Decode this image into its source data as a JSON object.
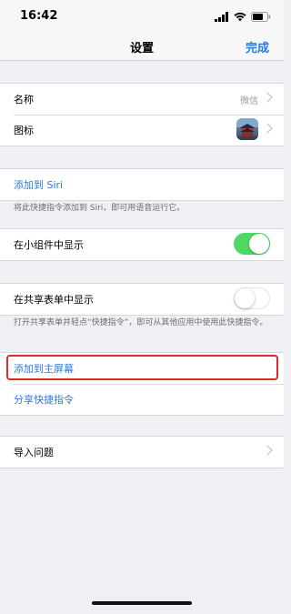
{
  "status_bar": {
    "time": "16:42"
  },
  "nav": {
    "title": "设置",
    "done_label": "完成"
  },
  "name_section": {
    "name_label": "名称",
    "name_value": "微信",
    "icon_label": "图标"
  },
  "siri_section": {
    "add_label": "添加到 Siri",
    "footnote": "将此快捷指令添加到 Siri，即可用语音运行它。"
  },
  "widget_section": {
    "label": "在小组件中显示",
    "toggle_on": true
  },
  "share_section": {
    "label": "在共享表单中显示",
    "toggle_on": false,
    "footnote": "打开共享表单并轻点“快捷指令”，即可从其他应用中使用此快捷指令。"
  },
  "actions_section": {
    "add_home_label": "添加到主屏幕",
    "share_label": "分享快捷指令"
  },
  "import_section": {
    "label": "导入问题"
  },
  "colors": {
    "accent": "#2c7bd8",
    "toggle_on": "#4cd964",
    "highlight": "#e0282c",
    "background": "#efeff4"
  }
}
